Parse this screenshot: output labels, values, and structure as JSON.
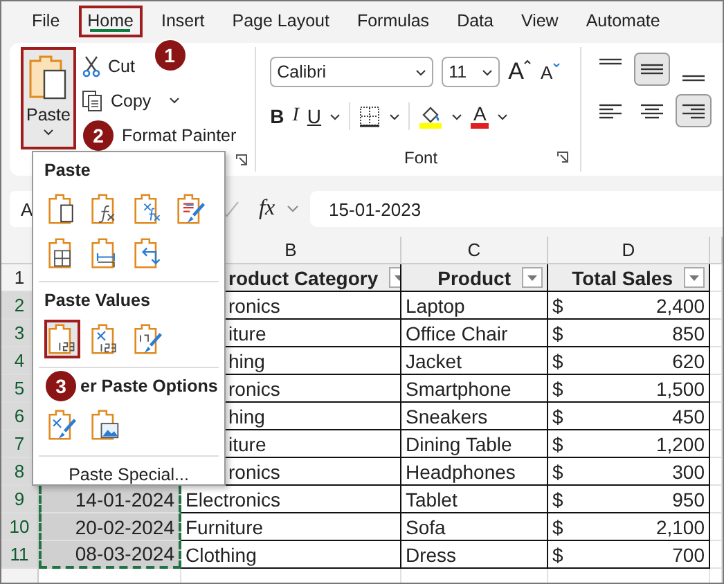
{
  "tabs": [
    {
      "label": "File",
      "selected": false,
      "highlighted": false
    },
    {
      "label": "Home",
      "selected": true,
      "highlighted": true,
      "callout": "1"
    },
    {
      "label": "Insert",
      "selected": false,
      "highlighted": false
    },
    {
      "label": "Page Layout",
      "selected": false,
      "highlighted": false
    },
    {
      "label": "Formulas",
      "selected": false,
      "highlighted": false
    },
    {
      "label": "Data",
      "selected": false,
      "highlighted": false
    },
    {
      "label": "View",
      "selected": false,
      "highlighted": false
    },
    {
      "label": "Automate",
      "selected": false,
      "highlighted": false
    }
  ],
  "clipboard": {
    "paste": {
      "label": "Paste",
      "highlighted": true
    },
    "cut": "Cut",
    "copy": "Copy",
    "format_painter": "Format Painter",
    "format_painter_callout": "2"
  },
  "font": {
    "name": "Calibri",
    "size": "11",
    "grow": "A",
    "shrink": "A",
    "bold": "B",
    "italic": "I",
    "underline": "U",
    "font_color": "A",
    "group_label": "Font"
  },
  "alignment": [
    {
      "kind": "top",
      "selected": false
    },
    {
      "kind": "middle",
      "selected": true
    },
    {
      "kind": "bottom",
      "selected": false
    },
    {
      "kind": "left",
      "selected": false
    },
    {
      "kind": "center",
      "selected": false
    },
    {
      "kind": "right",
      "selected": true
    }
  ],
  "paste_menu": {
    "sections": [
      {
        "title": "Paste",
        "options": [
          {
            "kind": "all",
            "highlighted": false
          },
          {
            "kind": "formulas",
            "highlighted": false
          },
          {
            "kind": "formulas-number",
            "highlighted": false
          },
          {
            "kind": "source-formatting",
            "highlighted": false
          },
          {
            "kind": "no-borders",
            "highlighted": false
          },
          {
            "kind": "column-widths",
            "highlighted": false
          },
          {
            "kind": "transpose",
            "highlighted": false
          }
        ]
      },
      {
        "title": "Paste Values",
        "options": [
          {
            "kind": "values",
            "highlighted": true
          },
          {
            "kind": "values-number",
            "highlighted": false
          },
          {
            "kind": "values-source",
            "highlighted": false
          }
        ]
      },
      {
        "title": "er Paste Options",
        "callout": "3",
        "options": [
          {
            "kind": "formatting",
            "highlighted": false
          },
          {
            "kind": "picture",
            "highlighted": false
          }
        ]
      }
    ],
    "special": "Paste Special..."
  },
  "formula_bar": {
    "name_box": "A",
    "fx": "fx",
    "value": "15-01-2023"
  },
  "columns": [
    "B",
    "C",
    "D"
  ],
  "header": {
    "row": "1",
    "b": "roduct Category",
    "c": "Product",
    "d": "Total Sales"
  },
  "rows": [
    {
      "row": "2",
      "selected": true,
      "b": "ronics",
      "c": "Laptop",
      "currency": "$",
      "sales": "2,400"
    },
    {
      "row": "3",
      "selected": true,
      "b": "iture",
      "c": "Office Chair",
      "currency": "$",
      "sales": "850"
    },
    {
      "row": "4",
      "selected": true,
      "b": "hing",
      "c": "Jacket",
      "currency": "$",
      "sales": "620"
    },
    {
      "row": "5",
      "selected": true,
      "b": "ronics",
      "c": "Smartphone",
      "currency": "$",
      "sales": "1,500"
    },
    {
      "row": "6",
      "selected": true,
      "b": "hing",
      "c": "Sneakers",
      "currency": "$",
      "sales": "450"
    },
    {
      "row": "7",
      "selected": true,
      "b": "iture",
      "c": "Dining Table",
      "currency": "$",
      "sales": "1,200"
    },
    {
      "row": "8",
      "selected": true,
      "b": "ronics",
      "c": "Headphones",
      "currency": "$",
      "sales": "300"
    },
    {
      "row": "9",
      "selected": true,
      "a": "14-01-2024",
      "in_copy_range": true,
      "b": "Electronics",
      "c": "Tablet",
      "currency": "$",
      "sales": "950"
    },
    {
      "row": "10",
      "selected": true,
      "a": "20-02-2024",
      "in_copy_range": true,
      "b": "Furniture",
      "c": "Sofa",
      "currency": "$",
      "sales": "2,100"
    },
    {
      "row": "11",
      "selected": true,
      "a": "08-03-2024",
      "in_copy_range": true,
      "b": "Clothing",
      "c": "Dress",
      "currency": "$",
      "sales": "700"
    }
  ]
}
